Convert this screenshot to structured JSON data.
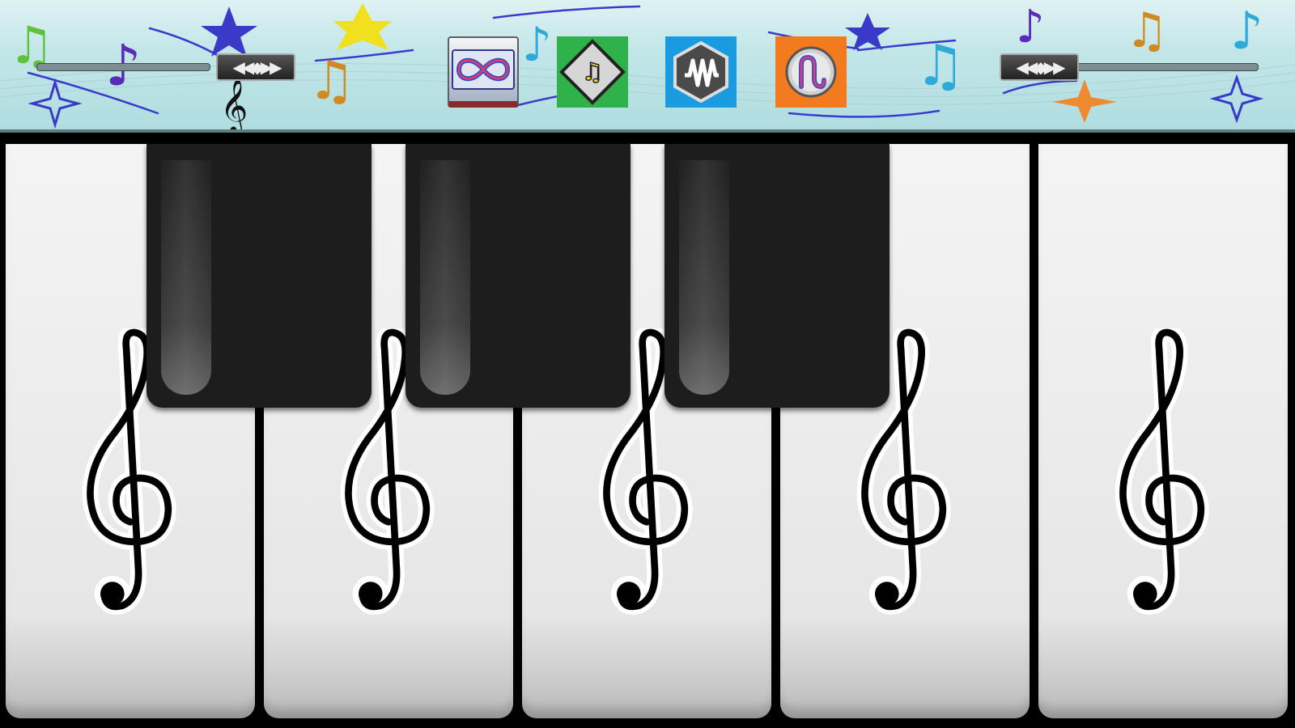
{
  "toolbar": {
    "left_slider": {
      "label": "left-keyboard-range-slider",
      "knob_glyph": "◀◀◆▶▶"
    },
    "right_slider": {
      "label": "right-keyboard-range-slider",
      "knob_glyph": "◀◀◆▶▶"
    },
    "buttons": [
      {
        "id": "loop",
        "icon": "infinity-icon"
      },
      {
        "id": "notes",
        "icon": "note-letters-icon"
      },
      {
        "id": "wave",
        "icon": "waveform-icon"
      },
      {
        "id": "record",
        "icon": "squiggle-icon"
      }
    ],
    "colors": {
      "background": "#c2e6e8",
      "notes_button": "#2fb24a",
      "wave_button": "#1a9be0",
      "record_button": "#f47a20"
    }
  },
  "keyboard": {
    "white_keys": 5,
    "black_keys": 3,
    "key_icon": "treble-clef-icon",
    "colors": {
      "white_key": "#e8e8e8",
      "black_key": "#1d1d1d"
    }
  }
}
